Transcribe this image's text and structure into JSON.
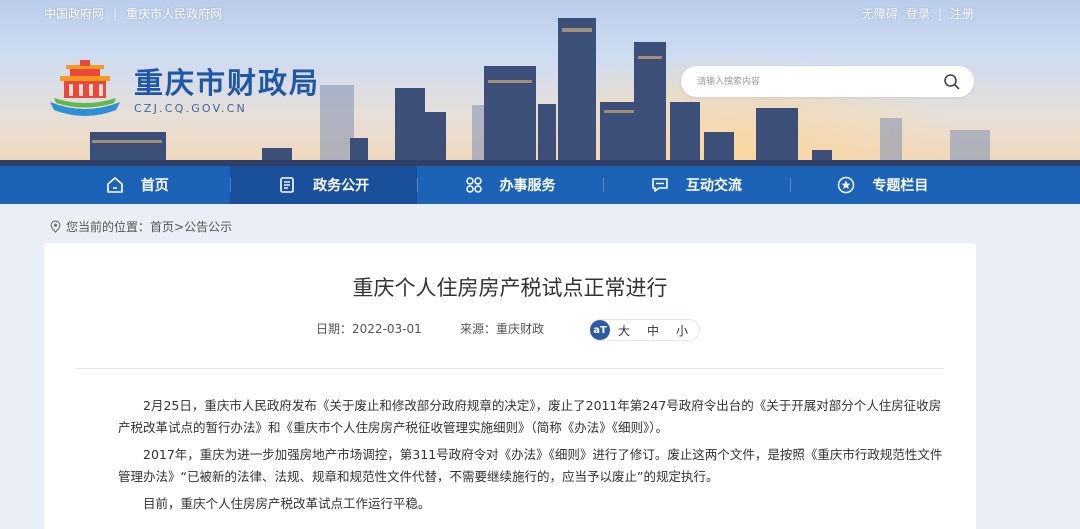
{
  "topbar": {
    "links_left": [
      "中国政府网",
      "重庆市人民政府网"
    ],
    "separator": "|",
    "links_right": [
      "无障碍",
      "登录",
      "注册"
    ]
  },
  "logo": {
    "title": "重庆市财政局",
    "domain": "CZJ.CQ.GOV.CN"
  },
  "search": {
    "placeholder": "请输入搜索内容",
    "icon": "search-icon"
  },
  "nav": {
    "items": [
      {
        "label": "首页",
        "icon": "home-icon"
      },
      {
        "label": "政务公开",
        "icon": "document-icon"
      },
      {
        "label": "办事服务",
        "icon": "services-grid-icon"
      },
      {
        "label": "互动交流",
        "icon": "chat-icon"
      },
      {
        "label": "专题栏目",
        "icon": "star-icon"
      }
    ],
    "active_index": 1,
    "colors": {
      "bar": "#1c62b6",
      "active": "#1a4f9b"
    }
  },
  "breadcrumb": {
    "prefix": "您当前的位置：",
    "home": "首页",
    "sep": ">",
    "current": "公告公示"
  },
  "article": {
    "title": "重庆个人住房房产税试点正常进行",
    "date": "日期：2022-03-01",
    "source": "来源：重庆财政",
    "font_badge": "aT",
    "font_options": [
      "大",
      "中",
      "小"
    ],
    "paragraphs": [
      "2月25日，重庆市人民政府发布《关于废止和修改部分政府规章的决定》，废止了2011年第247号政府令出台的《关于开展对部分个人住房征收房产税改革试点的暂行办法》和《重庆市个人住房房产税征收管理实施细则》（简称《办法》《细则》）。",
      "2017年，重庆为进一步加强房地产市场调控，第311号政府令对《办法》《细则》进行了修订。废止这两个文件，是按照《重庆市行政规范性文件管理办法》“已被新的法律、法规、规章和规范性文件代替，不需要继续施行的，应当予以废止”的规定执行。",
      "目前，重庆个人住房房产税改革试点工作运行平稳。"
    ]
  }
}
